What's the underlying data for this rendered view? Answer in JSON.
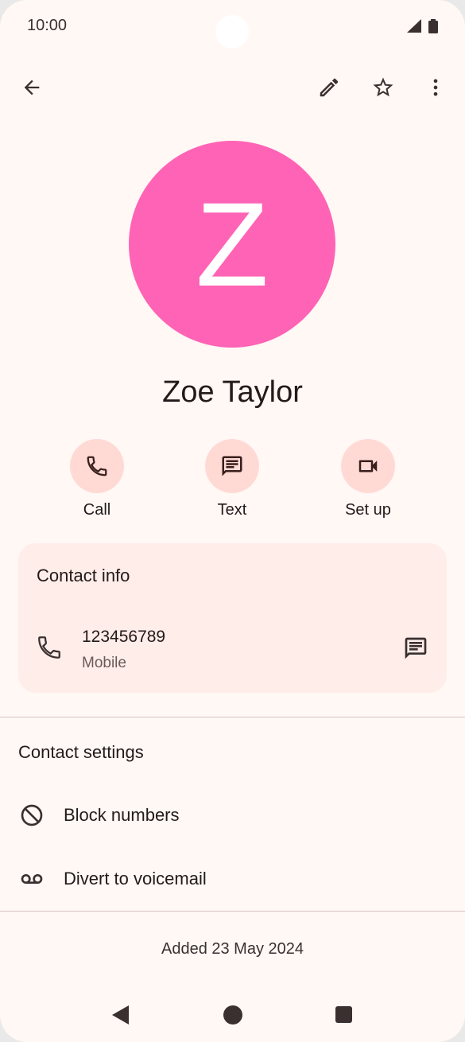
{
  "status_bar": {
    "time": "10:00"
  },
  "contact": {
    "initial": "Z",
    "name": "Zoe Taylor",
    "avatar_color": "#ff63b5"
  },
  "actions": [
    {
      "label": "Call",
      "icon": "phone-icon"
    },
    {
      "label": "Text",
      "icon": "message-icon"
    },
    {
      "label": "Set up",
      "icon": "video-icon"
    }
  ],
  "contact_info": {
    "title": "Contact info",
    "number": "123456789",
    "type": "Mobile"
  },
  "settings": {
    "title": "Contact settings",
    "items": [
      {
        "label": "Block numbers",
        "icon": "block-icon"
      },
      {
        "label": "Divert to voicemail",
        "icon": "voicemail-icon"
      }
    ]
  },
  "footer": {
    "added": "Added 23 May 2024"
  },
  "colors": {
    "background": "#fff8f5",
    "card": "#ffede9",
    "action_circle": "#ffdad5",
    "text": "#231a1a"
  }
}
